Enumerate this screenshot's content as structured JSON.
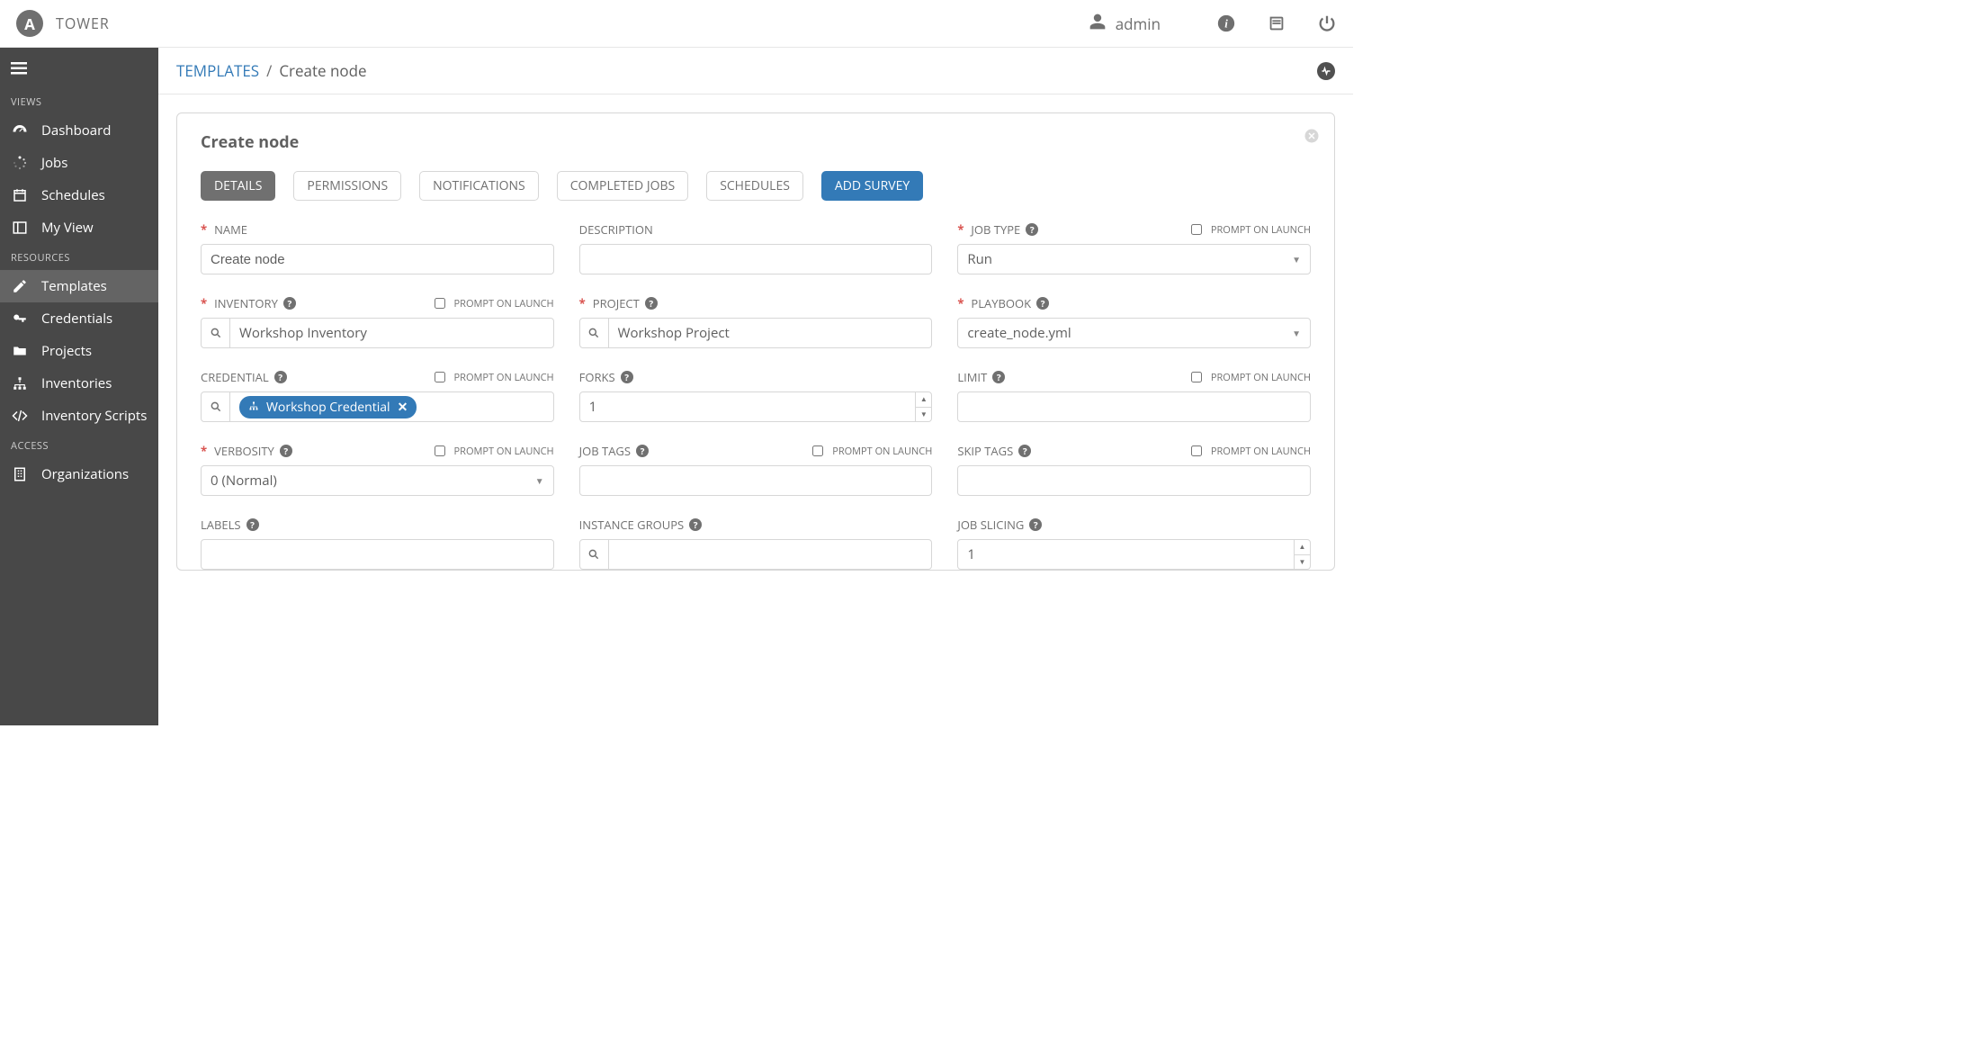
{
  "app": {
    "title": "TOWER",
    "logo_letter": "A"
  },
  "header": {
    "username": "admin"
  },
  "sidebar": {
    "sections": [
      {
        "header": "VIEWS",
        "items": [
          {
            "label": "Dashboard"
          },
          {
            "label": "Jobs"
          },
          {
            "label": "Schedules"
          },
          {
            "label": "My View"
          }
        ]
      },
      {
        "header": "RESOURCES",
        "items": [
          {
            "label": "Templates",
            "active": true
          },
          {
            "label": "Credentials"
          },
          {
            "label": "Projects"
          },
          {
            "label": "Inventories"
          },
          {
            "label": "Inventory Scripts"
          }
        ]
      },
      {
        "header": "ACCESS",
        "items": [
          {
            "label": "Organizations"
          }
        ]
      }
    ]
  },
  "breadcrumb": {
    "root": "TEMPLATES",
    "current": "Create node"
  },
  "card": {
    "title": "Create node"
  },
  "tabs": {
    "details": "DETAILS",
    "permissions": "PERMISSIONS",
    "notifications": "NOTIFICATIONS",
    "completed_jobs": "COMPLETED JOBS",
    "schedules": "SCHEDULES",
    "add_survey": "ADD SURVEY"
  },
  "labels": {
    "name": "NAME",
    "description": "DESCRIPTION",
    "job_type": "JOB TYPE",
    "inventory": "INVENTORY",
    "project": "PROJECT",
    "playbook": "PLAYBOOK",
    "credential": "CREDENTIAL",
    "forks": "FORKS",
    "limit": "LIMIT",
    "verbosity": "VERBOSITY",
    "job_tags": "JOB TAGS",
    "skip_tags": "SKIP TAGS",
    "labels_field": "LABELS",
    "instance_groups": "INSTANCE GROUPS",
    "job_slicing": "JOB SLICING",
    "prompt_on_launch": "PROMPT ON LAUNCH"
  },
  "values": {
    "name": "Create node",
    "description": "",
    "job_type": "Run",
    "inventory": "Workshop Inventory",
    "project": "Workshop Project",
    "playbook": "create_node.yml",
    "credential": "Workshop Credential",
    "forks": "1",
    "limit": "",
    "verbosity": "0 (Normal)",
    "job_tags": "",
    "skip_tags": "",
    "labels": "",
    "instance_groups": "",
    "job_slicing": "1"
  }
}
